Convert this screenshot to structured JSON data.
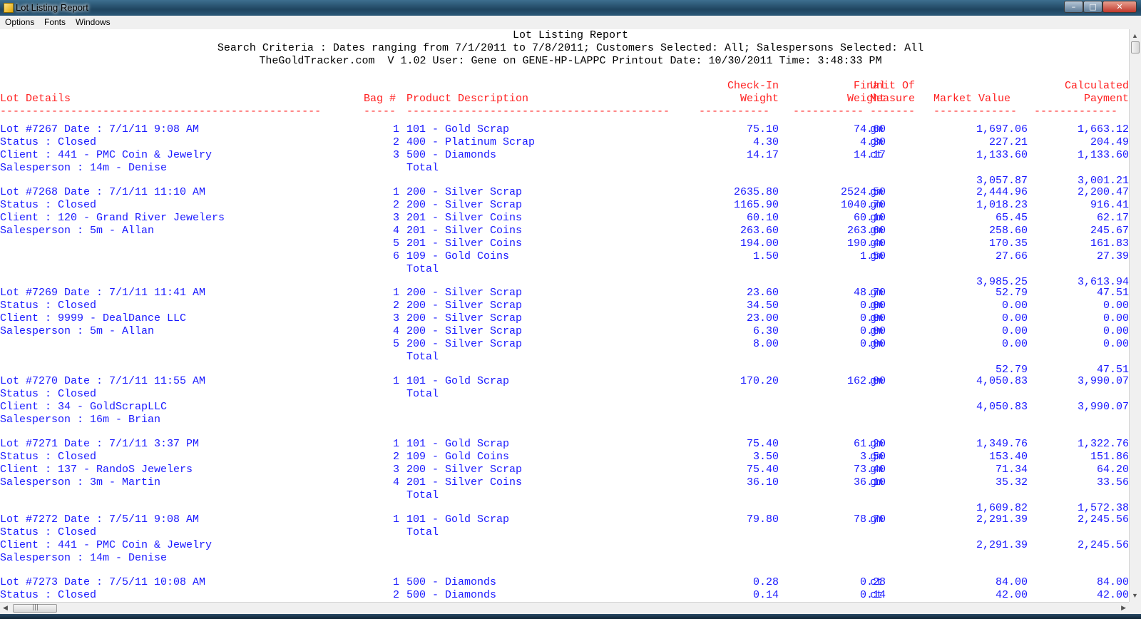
{
  "window": {
    "title": "Lot Listing Report",
    "minimize_glyph": "–",
    "maximize_glyph": "□",
    "close_glyph": "✕",
    "icon": "app-icon"
  },
  "menu": [
    "Options",
    "Fonts",
    "Windows"
  ],
  "report_header": {
    "title": "Lot Listing Report",
    "criteria": "Search Criteria : Dates ranging from 7/1/2011 to 7/8/2011; Customers Selected: All; Salespersons Selected: All",
    "info": "TheGoldTracker.com  V 1.02 User: Gene on GENE-HP-LAPPC Printout Date: 10/30/2011 Time: 3:48:33 PM"
  },
  "columns": {
    "lot_details": "Lot Details",
    "bag": "Bag #",
    "product": "Product Description",
    "checkin_1": "Check-In",
    "checkin_2": "Weight",
    "final_1": "Final",
    "final_2": "Weight",
    "uom_1": "Unit Of",
    "uom_2": "Measure",
    "market": "Market Value",
    "calc_1": "Calculated",
    "calc_2": "Payment",
    "sep_lot": "--------------------------------------------------",
    "sep_bag": "-----",
    "sep_prod": "-----------------------------------------",
    "sep_checkin": "-----------",
    "sep_final": "-----------",
    "sep_uom": "-------",
    "sep_market": "-------------",
    "sep_calc": "-------------"
  },
  "total_label": "Total",
  "lots": [
    {
      "line1": "Lot #7267 Date : 7/1/11 9:08 AM",
      "status": "Status : Closed",
      "client": "Client : 441 - PMC Coin & Jewelry",
      "salesperson": "Salesperson : 14m - Denise",
      "items": [
        {
          "bag": "1",
          "product": "101 - Gold Scrap",
          "checkin": "75.10",
          "final": "74.60",
          "uom": "gm",
          "market": "1,697.06",
          "payment": "1,663.12"
        },
        {
          "bag": "2",
          "product": "400 - Platinum Scrap",
          "checkin": "4.30",
          "final": "4.30",
          "uom": "gm",
          "market": "227.21",
          "payment": "204.49"
        },
        {
          "bag": "3",
          "product": "500 - Diamonds",
          "checkin": "14.17",
          "final": "14.17",
          "uom": "ct",
          "market": "1,133.60",
          "payment": "1,133.60"
        }
      ],
      "total_market": "3,057.87",
      "total_payment": "3,001.21"
    },
    {
      "line1": "Lot #7268 Date : 7/1/11 11:10 AM",
      "status": "Status : Closed",
      "client": "Client : 120 - Grand River Jewelers",
      "salesperson": "Salesperson : 5m - Allan",
      "items": [
        {
          "bag": "1",
          "product": "200 - Silver Scrap",
          "checkin": "2635.80",
          "final": "2524.50",
          "uom": "gm",
          "market": "2,444.96",
          "payment": "2,200.47"
        },
        {
          "bag": "2",
          "product": "200 - Silver Scrap",
          "checkin": "1165.90",
          "final": "1040.70",
          "uom": "gm",
          "market": "1,018.23",
          "payment": "916.41"
        },
        {
          "bag": "3",
          "product": "201 - Silver Coins",
          "checkin": "60.10",
          "final": "60.10",
          "uom": "gm",
          "market": "65.45",
          "payment": "62.17"
        },
        {
          "bag": "4",
          "product": "201 - Silver Coins",
          "checkin": "263.60",
          "final": "263.60",
          "uom": "gm",
          "market": "258.60",
          "payment": "245.67"
        },
        {
          "bag": "5",
          "product": "201 - Silver Coins",
          "checkin": "194.00",
          "final": "190.40",
          "uom": "gm",
          "market": "170.35",
          "payment": "161.83"
        },
        {
          "bag": "6",
          "product": "109 - Gold Coins",
          "checkin": "1.50",
          "final": "1.50",
          "uom": "gm",
          "market": "27.66",
          "payment": "27.39"
        }
      ],
      "total_market": "3,985.25",
      "total_payment": "3,613.94"
    },
    {
      "line1": "Lot #7269 Date : 7/1/11 11:41 AM",
      "status": "Status : Closed",
      "client": "Client : 9999 - DealDance LLC",
      "salesperson": "Salesperson : 5m - Allan",
      "items": [
        {
          "bag": "1",
          "product": "200 - Silver Scrap",
          "checkin": "23.60",
          "final": "48.70",
          "uom": "gm",
          "market": "52.79",
          "payment": "47.51"
        },
        {
          "bag": "2",
          "product": "200 - Silver Scrap",
          "checkin": "34.50",
          "final": "0.00",
          "uom": "gm",
          "market": "0.00",
          "payment": "0.00"
        },
        {
          "bag": "3",
          "product": "200 - Silver Scrap",
          "checkin": "23.00",
          "final": "0.00",
          "uom": "gm",
          "market": "0.00",
          "payment": "0.00"
        },
        {
          "bag": "4",
          "product": "200 - Silver Scrap",
          "checkin": "6.30",
          "final": "0.00",
          "uom": "gm",
          "market": "0.00",
          "payment": "0.00"
        },
        {
          "bag": "5",
          "product": "200 - Silver Scrap",
          "checkin": "8.00",
          "final": "0.00",
          "uom": "gm",
          "market": "0.00",
          "payment": "0.00"
        }
      ],
      "total_market": "52.79",
      "total_payment": "47.51"
    },
    {
      "line1": "Lot #7270 Date : 7/1/11 11:55 AM",
      "status": "Status : Closed",
      "client": "Client : 34 - GoldScrapLLC",
      "salesperson": "Salesperson : 16m - Brian",
      "items": [
        {
          "bag": "1",
          "product": "101 - Gold Scrap",
          "checkin": "170.20",
          "final": "162.00",
          "uom": "gm",
          "market": "4,050.83",
          "payment": "3,990.07"
        }
      ],
      "total_market": "4,050.83",
      "total_payment": "3,990.07"
    },
    {
      "line1": "Lot #7271 Date : 7/1/11 3:37 PM",
      "status": "Status : Closed",
      "client": "Client : 137 - RandoS Jewelers",
      "salesperson": "Salesperson : 3m - Martin",
      "items": [
        {
          "bag": "1",
          "product": "101 - Gold Scrap",
          "checkin": "75.40",
          "final": "61.20",
          "uom": "gm",
          "market": "1,349.76",
          "payment": "1,322.76"
        },
        {
          "bag": "2",
          "product": "109 - Gold Coins",
          "checkin": "3.50",
          "final": "3.50",
          "uom": "gm",
          "market": "153.40",
          "payment": "151.86"
        },
        {
          "bag": "3",
          "product": "200 - Silver Scrap",
          "checkin": "75.40",
          "final": "73.40",
          "uom": "gm",
          "market": "71.34",
          "payment": "64.20"
        },
        {
          "bag": "4",
          "product": "201 - Silver Coins",
          "checkin": "36.10",
          "final": "36.10",
          "uom": "gm",
          "market": "35.32",
          "payment": "33.56"
        }
      ],
      "total_market": "1,609.82",
      "total_payment": "1,572.38"
    },
    {
      "line1": "Lot #7272 Date : 7/5/11 9:08 AM",
      "status": "Status : Closed",
      "client": "Client : 441 - PMC Coin & Jewelry",
      "salesperson": "Salesperson : 14m - Denise",
      "items": [
        {
          "bag": "1",
          "product": "101 - Gold Scrap",
          "checkin": "79.80",
          "final": "78.70",
          "uom": "gm",
          "market": "2,291.39",
          "payment": "2,245.56"
        }
      ],
      "total_market": "2,291.39",
      "total_payment": "2,245.56"
    },
    {
      "line1": "Lot #7273 Date : 7/5/11 10:08 AM",
      "status": "Status : Closed",
      "client": "",
      "salesperson": "",
      "items": [
        {
          "bag": "1",
          "product": "500 - Diamonds",
          "checkin": "0.28",
          "final": "0.28",
          "uom": "ct",
          "market": "84.00",
          "payment": "84.00"
        },
        {
          "bag": "2",
          "product": "500 - Diamonds",
          "checkin": "0.14",
          "final": "0.14",
          "uom": "ct",
          "market": "42.00",
          "payment": "42.00"
        }
      ],
      "total_market": "",
      "total_payment": ""
    }
  ]
}
